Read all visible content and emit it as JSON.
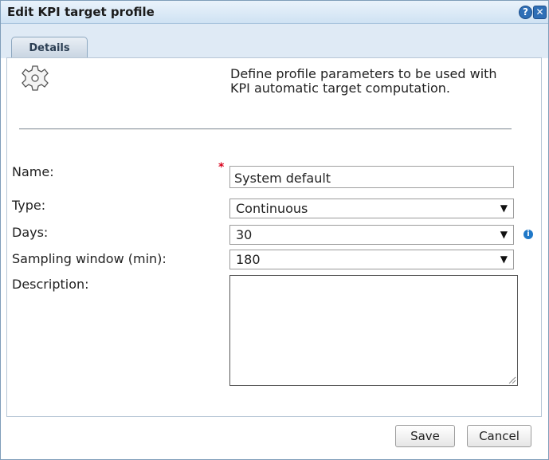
{
  "dialog": {
    "title": "Edit KPI target profile",
    "help_glyph": "?",
    "close_glyph": "✕"
  },
  "tabs": [
    {
      "label": "Details",
      "active": true
    }
  ],
  "intro": {
    "icon": "gear-icon",
    "text": "Define profile parameters to be used with KPI automatic target computation."
  },
  "form": {
    "name": {
      "label": "Name:",
      "required_mark": "*",
      "value": "System default"
    },
    "type": {
      "label": "Type:",
      "value": "Continuous"
    },
    "days": {
      "label": "Days:",
      "value": "30",
      "info_glyph": "i"
    },
    "sampling": {
      "label": "Sampling window (min):",
      "value": "180"
    },
    "description": {
      "label": "Description:",
      "value": ""
    }
  },
  "footer": {
    "save_label": "Save",
    "cancel_label": "Cancel"
  },
  "colors": {
    "title_bar": "#cfe2f3",
    "accent": "#2f6fb6",
    "required": "#d9001b",
    "info": "#1f78c8"
  }
}
